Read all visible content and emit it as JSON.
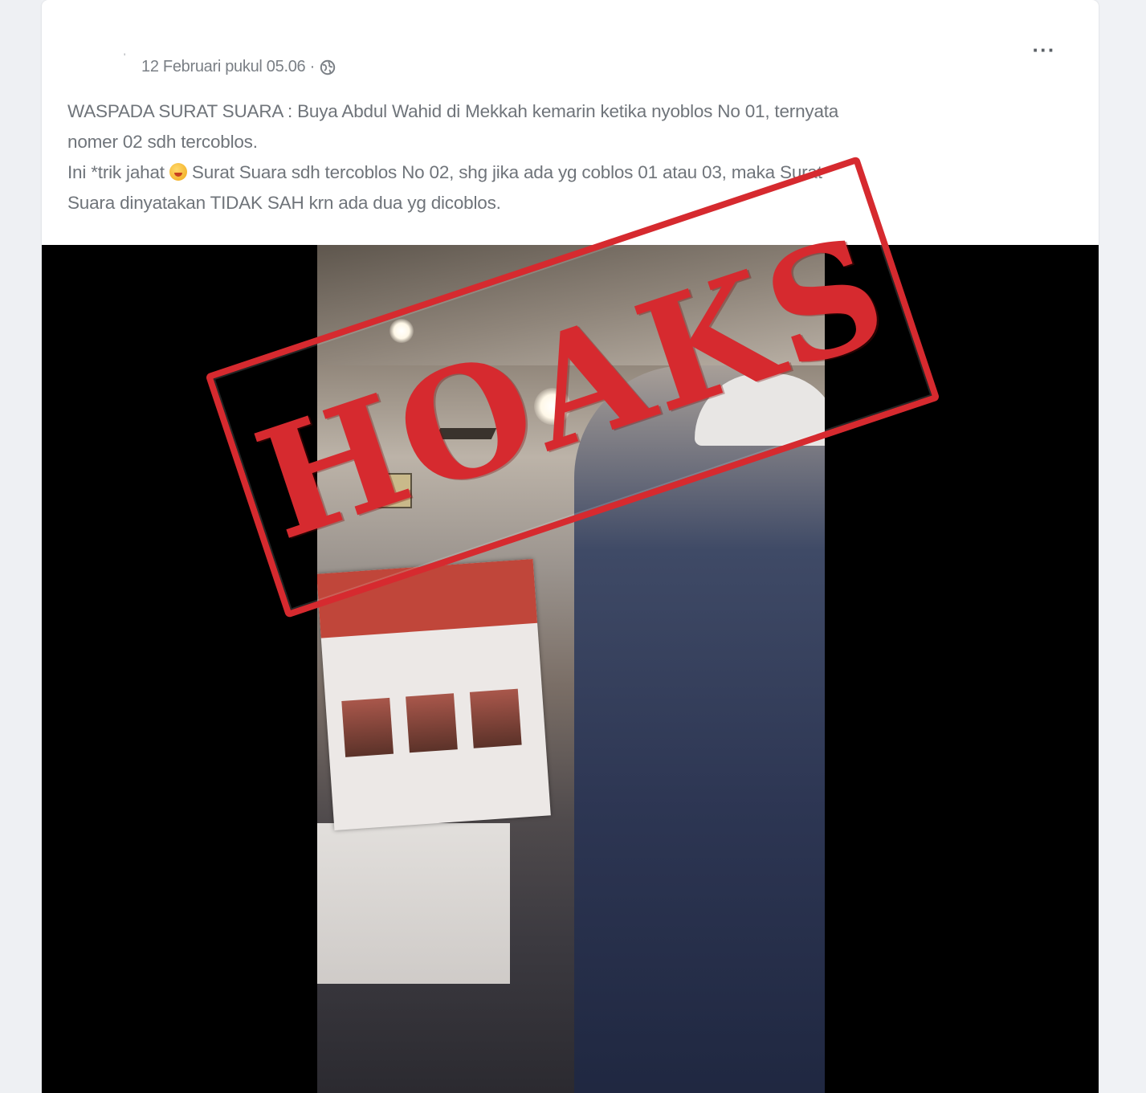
{
  "post": {
    "timestamp": "12 Februari pukul 05.06 ·",
    "privacy_icon": "globe-icon",
    "more_label": "···",
    "text_lines": [
      "WASPADA SURAT SUARA : Buya Abdul Wahid di Mekkah kemarin ketika nyoblos No 01, ternyata",
      "nomer 02 sdh tercoblos.",
      "Suara dinyatakan TIDAK SAH krn ada dua yg dicoblos."
    ],
    "line3_before_emoji": "Ini *trik jahat ",
    "line3_after_emoji": " Surat Suara sdh tercoblos No 02, shg jika ada yg coblos 01 atau 03, maka Surat",
    "emoji_icon": "grinning-face-emoji"
  },
  "video": {
    "stamp_label": "HOAKS"
  },
  "colors": {
    "stamp_red": "#d62a2f",
    "text_gray": "#6f747a",
    "background": "#f0f2f5"
  }
}
